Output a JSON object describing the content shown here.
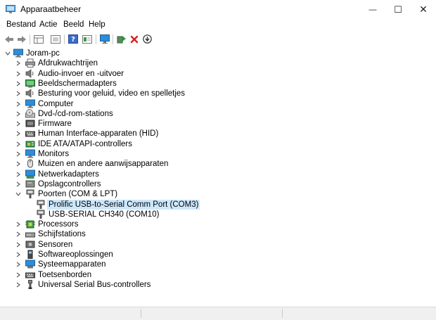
{
  "window": {
    "title": "Apparaatbeheer",
    "minimize_glyph": "—",
    "maximize_glyph": "☐",
    "close_glyph": "✕"
  },
  "menu": {
    "items": [
      "Bestand",
      "Actie",
      "Beeld",
      "Help"
    ]
  },
  "toolbar": {
    "buttons": [
      "back-arrow-icon",
      "forward-arrow-icon",
      "properties-grid-icon",
      "list-view-icon",
      "help-icon",
      "details-icon",
      "monitor-scan-icon",
      "update-driver-icon",
      "uninstall-icon",
      "download-icon"
    ]
  },
  "tree": {
    "root": "Joram-pc",
    "categories": [
      {
        "label": "Afdrukwachtrijen",
        "icon": "printer-icon"
      },
      {
        "label": "Audio-invoer en -uitvoer",
        "icon": "speaker-icon"
      },
      {
        "label": "Beeldschermadapters",
        "icon": "display-adapter-icon"
      },
      {
        "label": "Besturing voor geluid, video en spelletjes",
        "icon": "speaker-icon"
      },
      {
        "label": "Computer",
        "icon": "computer-icon"
      },
      {
        "label": "Dvd-/cd-rom-stations",
        "icon": "disc-drive-icon"
      },
      {
        "label": "Firmware",
        "icon": "firmware-icon"
      },
      {
        "label": "Human Interface-apparaten (HID)",
        "icon": "keyboard-hid-icon"
      },
      {
        "label": "IDE ATA/ATAPI-controllers",
        "icon": "controller-icon"
      },
      {
        "label": "Monitors",
        "icon": "monitor-icon"
      },
      {
        "label": "Muizen en andere aanwijsapparaten",
        "icon": "mouse-icon"
      },
      {
        "label": "Netwerkadapters",
        "icon": "network-adapter-icon"
      },
      {
        "label": "Opslagcontrollers",
        "icon": "storage-controller-icon"
      },
      {
        "label": "Poorten (COM & LPT)",
        "icon": "port-icon",
        "expanded": true,
        "children": [
          {
            "label": "Prolific USB-to-Serial Comm Port (COM3)",
            "icon": "port-icon",
            "selected": true
          },
          {
            "label": "USB-SERIAL CH340 (COM10)",
            "icon": "port-icon"
          }
        ]
      },
      {
        "label": "Processors",
        "icon": "processor-icon"
      },
      {
        "label": "Schijfstations",
        "icon": "disk-drive-icon"
      },
      {
        "label": "Sensoren",
        "icon": "sensor-icon"
      },
      {
        "label": "Softwareoplossingen",
        "icon": "software-icon"
      },
      {
        "label": "Systeemapparaten",
        "icon": "system-device-icon"
      },
      {
        "label": "Toetsenborden",
        "icon": "keyboard-icon"
      },
      {
        "label": "Universal Serial Bus-controllers",
        "icon": "usb-icon"
      }
    ]
  },
  "colors": {
    "selection": "#cce8ff",
    "monitor_blue": "#2f8dd8",
    "delete_red": "#d42020",
    "update_green": "#2e9a3c"
  }
}
